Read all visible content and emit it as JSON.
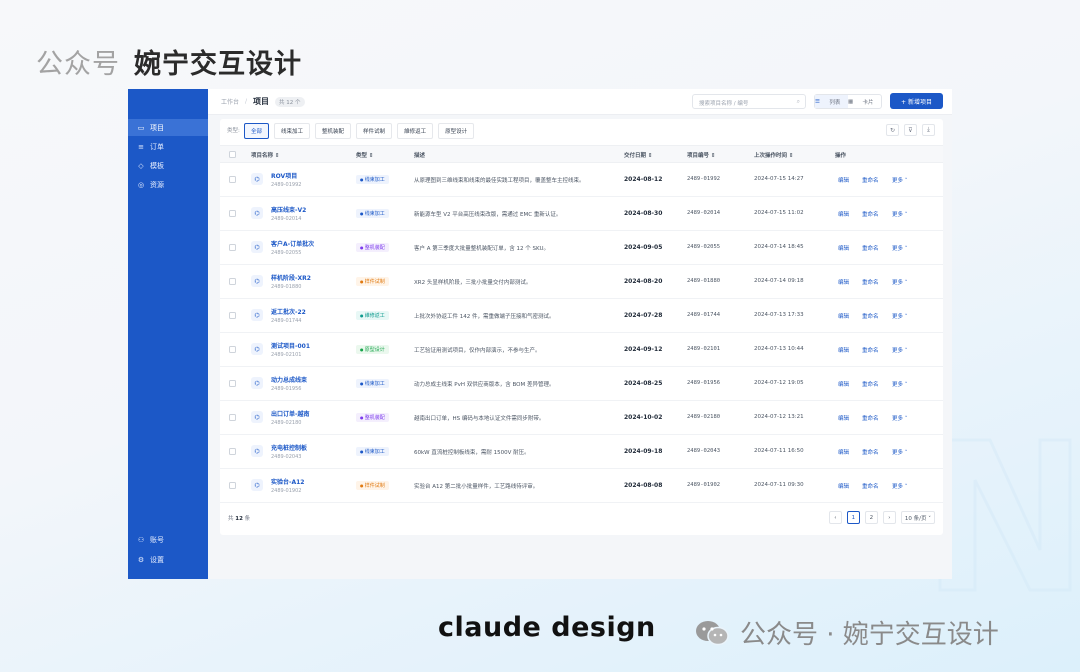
{
  "watermark_top": {
    "prefix": "公众号",
    "name": "婉宁交互设计"
  },
  "watermark_bottom": {
    "brand": "claude design",
    "account": "公众号 · 婉宁交互设计"
  },
  "colors": {
    "primary": "#1c58c7",
    "sidebar": "#1c58c7"
  },
  "sidebar": {
    "items": [
      {
        "icon": "folder-icon",
        "glyph": "▭",
        "label": "项目",
        "active": true
      },
      {
        "icon": "list-icon",
        "glyph": "≡",
        "label": "订单",
        "active": false
      },
      {
        "icon": "template-icon",
        "glyph": "◇",
        "label": "模板",
        "active": false
      },
      {
        "icon": "resource-icon",
        "glyph": "◎",
        "label": "资源",
        "active": false
      }
    ],
    "bottom": [
      {
        "icon": "user-icon",
        "glyph": "⚇",
        "label": "账号"
      },
      {
        "icon": "settings-icon",
        "glyph": "⚙",
        "label": "设置"
      }
    ]
  },
  "header": {
    "breadcrumb_root": "工作台",
    "title": "项目",
    "count": "共 12 个",
    "search_placeholder": "搜索项目名称 / 编号",
    "view_list": "列表",
    "view_card": "卡片",
    "new_button": "+ 新增项目"
  },
  "filter": {
    "label": "类型:",
    "chips": [
      {
        "label": "全部",
        "active": true
      },
      {
        "label": "线束加工",
        "active": false
      },
      {
        "label": "整机装配",
        "active": false
      },
      {
        "label": "样件试制",
        "active": false
      },
      {
        "label": "維修返工",
        "active": false
      },
      {
        "label": "原型设计",
        "active": false
      }
    ]
  },
  "table": {
    "headers": {
      "name": "项目名称 ⇕",
      "type": "类型 ⇕",
      "desc": "描述",
      "date": "交付日期 ⇕",
      "code": "项目编号 ⇕",
      "time": "上次操作时间 ⇕",
      "ops": "操作"
    },
    "actions": {
      "edit": "编辑",
      "rename": "重命名",
      "more": "更多 ˅"
    },
    "rows": [
      {
        "name": "ROV项目",
        "code": "2489-01992",
        "type": "线束加工",
        "tone": "blue",
        "desc": "从原理图到三维线束和线束的最佳实践工程项目，覆盖整车主控线束。",
        "date": "2024-08-12",
        "pcode": "2489-01992",
        "time": "2024-07-15 14:27"
      },
      {
        "name": "高压线束-V2",
        "code": "2489-02014",
        "type": "线束加工",
        "tone": "blue",
        "desc": "新能源车型 V2 平台高压线束改版，需通过 EMC 重新认证。",
        "date": "2024-08-30",
        "pcode": "2489-02014",
        "time": "2024-07-15 11:02"
      },
      {
        "name": "客户A-订单批次",
        "code": "2489-02055",
        "type": "整机装配",
        "tone": "purple",
        "desc": "客户 A 第三季度大批量整机装配订单，含 12 个 SKU。",
        "date": "2024-09-05",
        "pcode": "2489-02055",
        "time": "2024-07-14 18:45"
      },
      {
        "name": "样机阶段-XR2",
        "code": "2489-01880",
        "type": "样件试制",
        "tone": "orange",
        "desc": "XR2 头显样机阶段，三批小批量交付内部测试。",
        "date": "2024-08-20",
        "pcode": "2489-01880",
        "time": "2024-07-14 09:18"
      },
      {
        "name": "返工批次-22",
        "code": "2489-01744",
        "type": "維修返工",
        "tone": "teal",
        "desc": "上批次外协返工件 142 件，需重做端子压接和气密测试。",
        "date": "2024-07-28",
        "pcode": "2489-01744",
        "time": "2024-07-13 17:33"
      },
      {
        "name": "测试项目-001",
        "code": "2489-02101",
        "type": "原型设计",
        "tone": "green",
        "desc": "工艺验证用测试项目，仅作内部演示，不参与生产。",
        "date": "2024-09-12",
        "pcode": "2489-02101",
        "time": "2024-07-13 10:44"
      },
      {
        "name": "动力总成线束",
        "code": "2489-01956",
        "type": "线束加工",
        "tone": "blue",
        "desc": "动力总成主线束 PvH 双供应商版本，含 BOM 差异管理。",
        "date": "2024-08-25",
        "pcode": "2489-01956",
        "time": "2024-07-12 19:05"
      },
      {
        "name": "出口订单-越南",
        "code": "2489-02180",
        "type": "整机装配",
        "tone": "purple",
        "desc": "越南出口订单，HS 编码与本地认证文件需同步附带。",
        "date": "2024-10-02",
        "pcode": "2489-02180",
        "time": "2024-07-12 13:21"
      },
      {
        "name": "充电桩控制板",
        "code": "2489-02043",
        "type": "线束加工",
        "tone": "blue",
        "desc": "60kW 直流桩控制板线束，需耐 1500V 耐压。",
        "date": "2024-09-18",
        "pcode": "2489-02043",
        "time": "2024-07-11 16:50"
      },
      {
        "name": "实验台-A12",
        "code": "2489-01902",
        "type": "样件试制",
        "tone": "orange",
        "desc": "实验台 A12 第二批小批量样件，工艺路线待评审。",
        "date": "2024-08-08",
        "pcode": "2489-01902",
        "time": "2024-07-11 09:30"
      }
    ]
  },
  "footer": {
    "total_prefix": "共 ",
    "total_count": "12",
    "total_suffix": " 条",
    "pages": [
      "‹",
      "1",
      "2",
      "›"
    ],
    "current_page": "1",
    "page_size": "10 条/页 ˅"
  }
}
